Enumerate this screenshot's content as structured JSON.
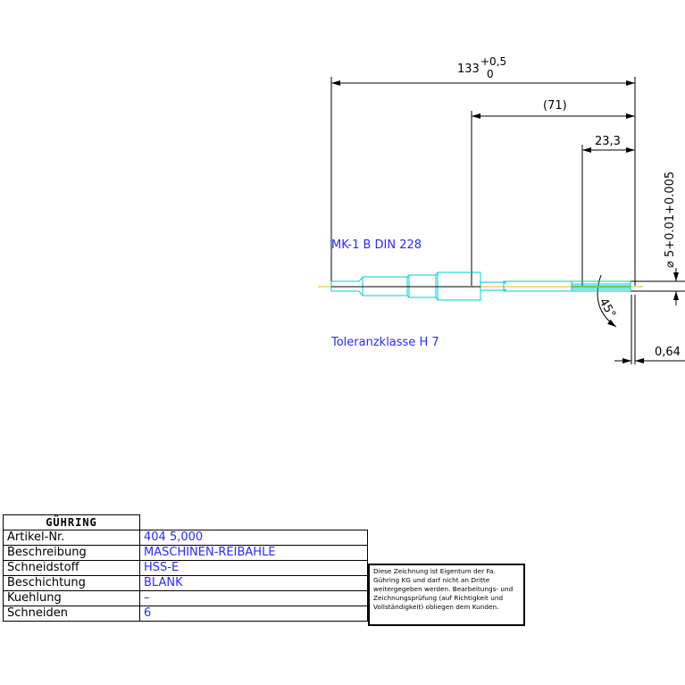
{
  "dimensions": {
    "overall_length": "133",
    "overall_tol_upper": "+0,5",
    "overall_tol_lower": "0",
    "shank_length": "(71)",
    "flute_length": "23,3",
    "diameter": "⌀ 5+0.01+0.005",
    "angle": "45°",
    "chamfer": "0,64"
  },
  "notes": {
    "taper": "MK-1 B DIN 228",
    "tolerance_class": "Toleranzklasse H 7"
  },
  "titleblock": {
    "logo": "GÜHRING",
    "rows": [
      {
        "label": "Artikel-Nr.",
        "value": "404 5,000"
      },
      {
        "label": "Beschreibung",
        "value": "MASCHINEN-REIBAHLE"
      },
      {
        "label": "Schneidstoff",
        "value": "HSS-E"
      },
      {
        "label": "Beschichtung",
        "value": "BLANK"
      },
      {
        "label": "Kuehlung",
        "value": "–"
      },
      {
        "label": "Schneiden",
        "value": "6"
      }
    ],
    "ownership": "Diese Zeichnung ist Eigentum der Fa. Gühring KG und darf nicht an Dritte weitergegeben werden. Bearbeitungs- und Zeichnungsprüfung (auf Richtigkeit und Vollständigkeit) obliegen dem Kunden."
  },
  "colors": {
    "dimension": "#000000",
    "annotation": "#2a2aff",
    "part_outline": "#00cccc",
    "centerline": "#e0c000"
  }
}
